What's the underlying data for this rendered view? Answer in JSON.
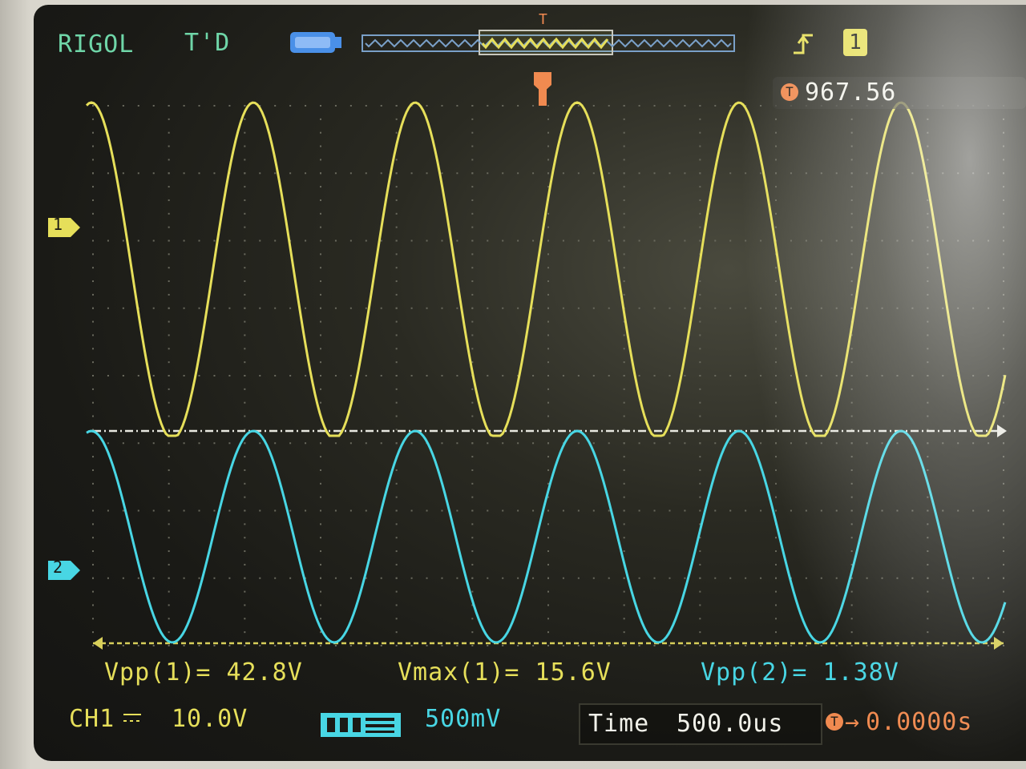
{
  "header": {
    "brand": "RIGOL",
    "trigger_status": "T'D",
    "trigger_marker": "T",
    "ch1_badge": "1",
    "trigger_time": "967.56"
  },
  "channels": {
    "ch1_marker": "1",
    "ch2_marker": "2"
  },
  "measurements": {
    "vpp1": "Vpp(1)= 42.8V",
    "vmax1": "Vmax(1)= 15.6V",
    "vpp2": "Vpp(2)= 1.38V"
  },
  "footer": {
    "ch1_label": "CH1",
    "ch1_coupling_icon": "dc-coupling-icon",
    "ch1_scale": "10.0V",
    "ch2_scale": "500mV",
    "time_label": "Time",
    "time_scale": "500.0us",
    "trigger_offset": "0.0000s"
  },
  "colors": {
    "ch1": "#e6df5a",
    "ch2": "#48d6e4",
    "trigger": "#f08a50",
    "brand": "#6fd6a8"
  }
}
